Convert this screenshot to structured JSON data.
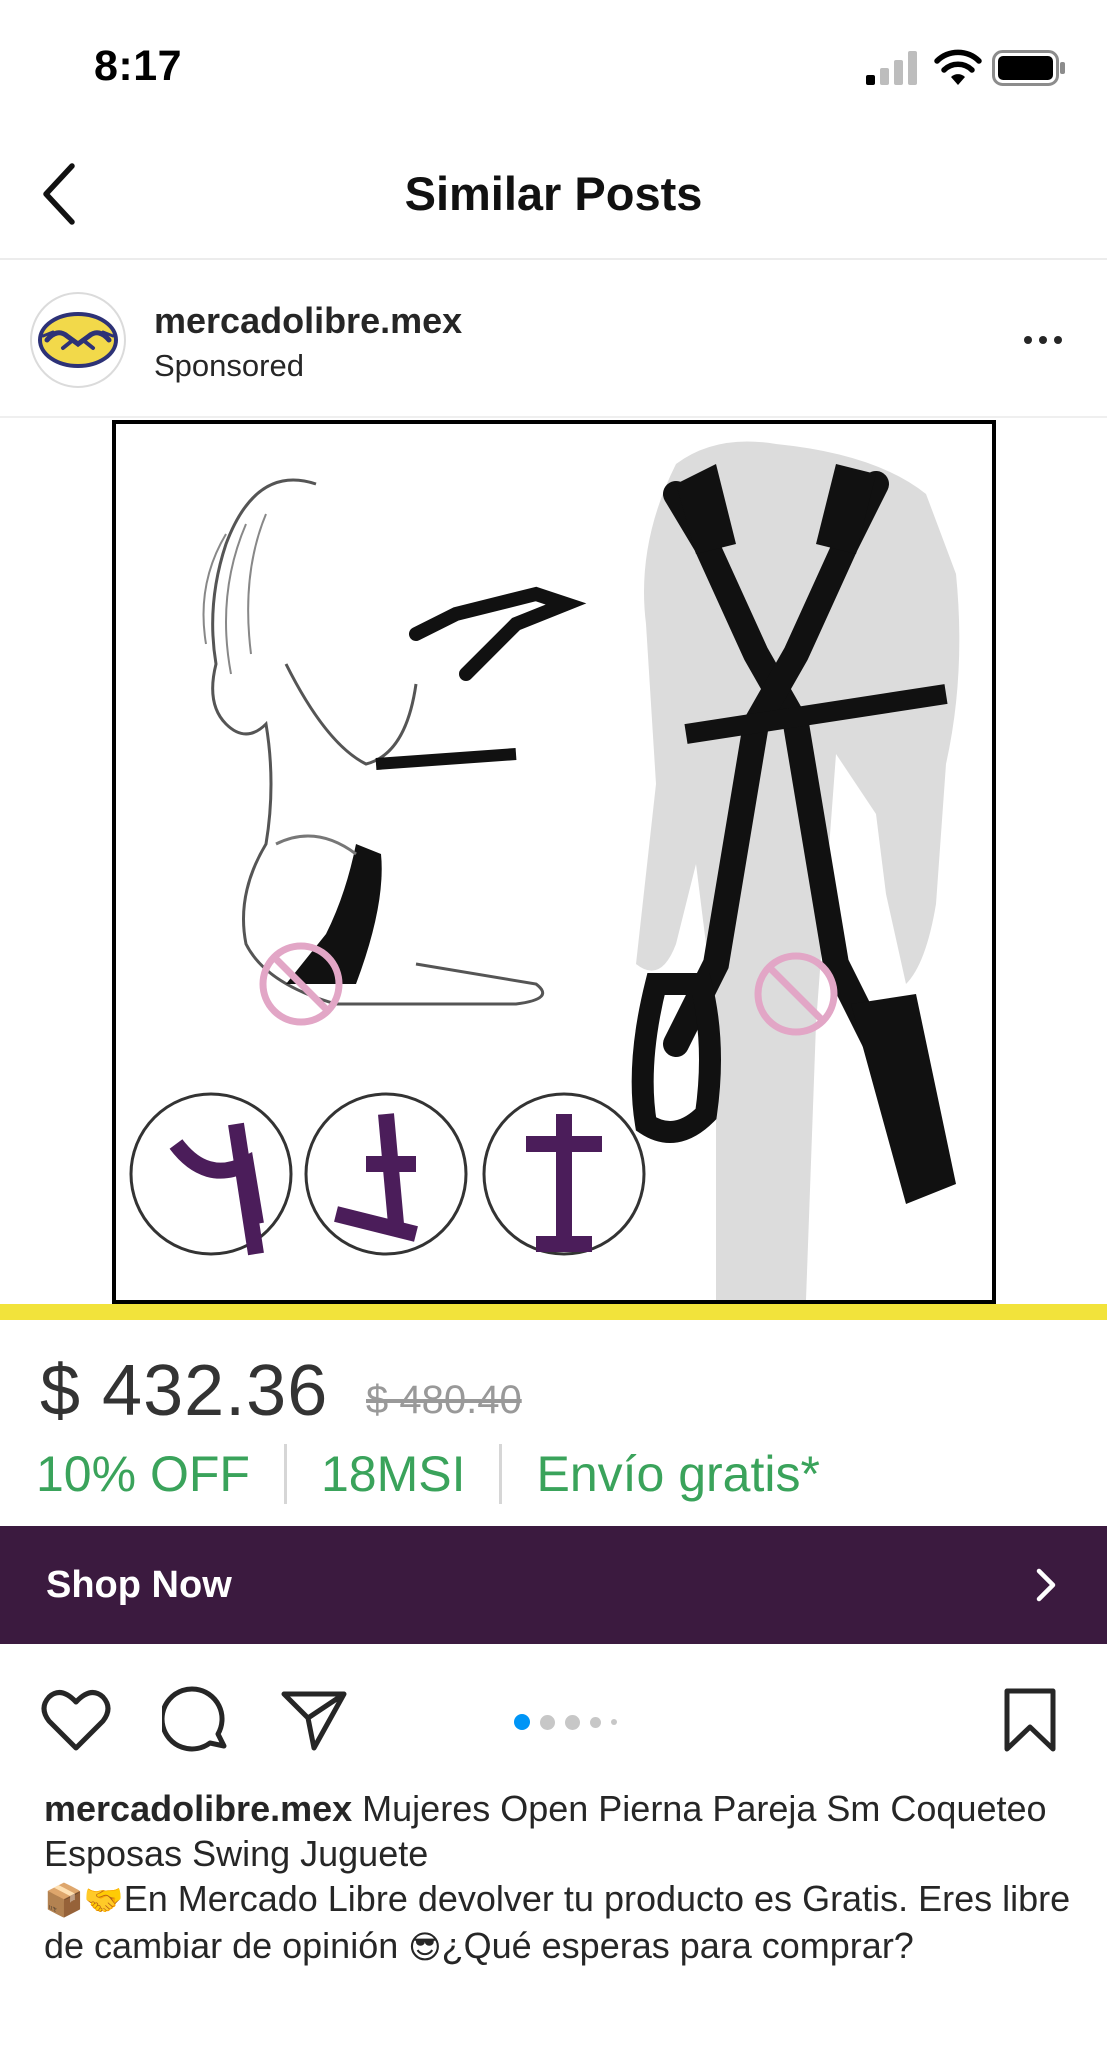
{
  "status_bar": {
    "time": "8:17",
    "icons": [
      "signal-icon",
      "wifi-icon",
      "battery-icon"
    ]
  },
  "nav": {
    "back_icon": "chevron-left-icon",
    "title": "Similar Posts"
  },
  "post": {
    "account": "mercadolibre.mex",
    "sponsored": "Sponsored",
    "more_icon": "ellipsis-icon"
  },
  "product": {
    "price": "$ 432.36",
    "original_price": "$ 480.40",
    "promos": [
      "10% OFF",
      "18MSI",
      "Envío gratis*"
    ]
  },
  "cta": {
    "label": "Shop Now",
    "icon": "chevron-right-icon",
    "background": "#3b1a3f"
  },
  "actions": {
    "icons": [
      "heart-icon",
      "comment-icon",
      "share-icon",
      "bookmark-icon"
    ],
    "carousel": {
      "count": 5,
      "active": 0,
      "active_color": "#0095f6"
    }
  },
  "caption": {
    "user": "mercadolibre.mex",
    "line1": "Mujeres Open Pierna Pareja Sm Coqueteo Esposas Swing Juguete",
    "emoji1": "📦🤝",
    "line2": "En Mercado Libre devolver tu producto es Gratis. Eres libre de cambiar de opinión",
    "emoji2": "😎",
    "line3": "¿Qué esperas para comprar?"
  },
  "colors": {
    "brand_yellow": "#f2e33b",
    "promo_green": "#3aa35b"
  }
}
